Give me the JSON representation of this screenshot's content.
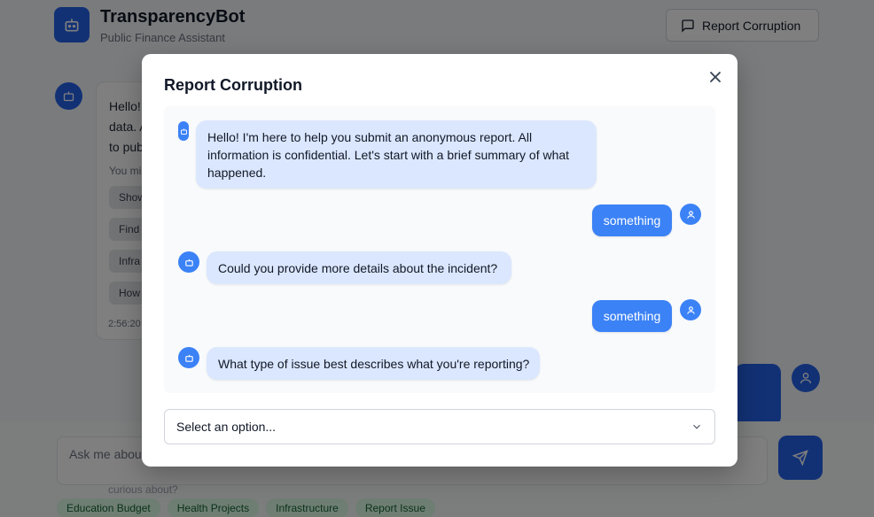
{
  "app": {
    "title": "TransparencyBot",
    "subtitle": "Public Finance Assistant",
    "report_button_label": "Report Corruption"
  },
  "background_chat": {
    "bot_message_lines": [
      "Hello! I",
      "data. A",
      "to publ"
    ],
    "suggest_label": "You mi",
    "suggestions": [
      "Show",
      "Find",
      "Infra",
      "How"
    ],
    "timestamp": "2:56:20",
    "input_placeholder": "Ask me about",
    "input_line2": "curious about?",
    "tags": [
      "Education Budget",
      "Health Projects",
      "Infrastructure",
      "Report Issue"
    ]
  },
  "modal": {
    "title": "Report Corruption",
    "messages": [
      {
        "role": "bot",
        "text": "Hello! I'm here to help you submit an anonymous report. All information is confidential. Let's start with a brief summary of what happened."
      },
      {
        "role": "user",
        "text": "something"
      },
      {
        "role": "bot",
        "text": "Could you provide more details about the incident?"
      },
      {
        "role": "user",
        "text": "something"
      },
      {
        "role": "bot",
        "text": "What type of issue best describes what you're reporting?"
      }
    ],
    "select": {
      "value": "Select an option..."
    }
  },
  "colors": {
    "primary": "#2563eb",
    "bubble_user": "#3b82f6",
    "bubble_bot": "#dbe7fe",
    "tag_bg": "#dcfce7",
    "tag_text": "#166534"
  }
}
